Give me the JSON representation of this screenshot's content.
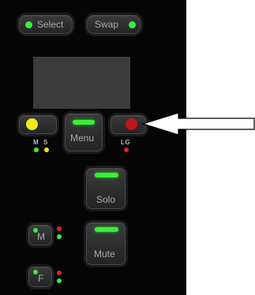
{
  "buttons": {
    "select": "Select",
    "swap": "Swap",
    "menu": "Menu",
    "solo": "Solo",
    "mute": "Mute",
    "m": "M",
    "f": "F"
  },
  "indicators": {
    "ms_m": "M",
    "ms_s": "S",
    "lg": "LG"
  },
  "colors": {
    "green": "#39ef3a",
    "yellow": "#f2ea19",
    "red": "#c0141c",
    "strip_bg": "#050505"
  }
}
